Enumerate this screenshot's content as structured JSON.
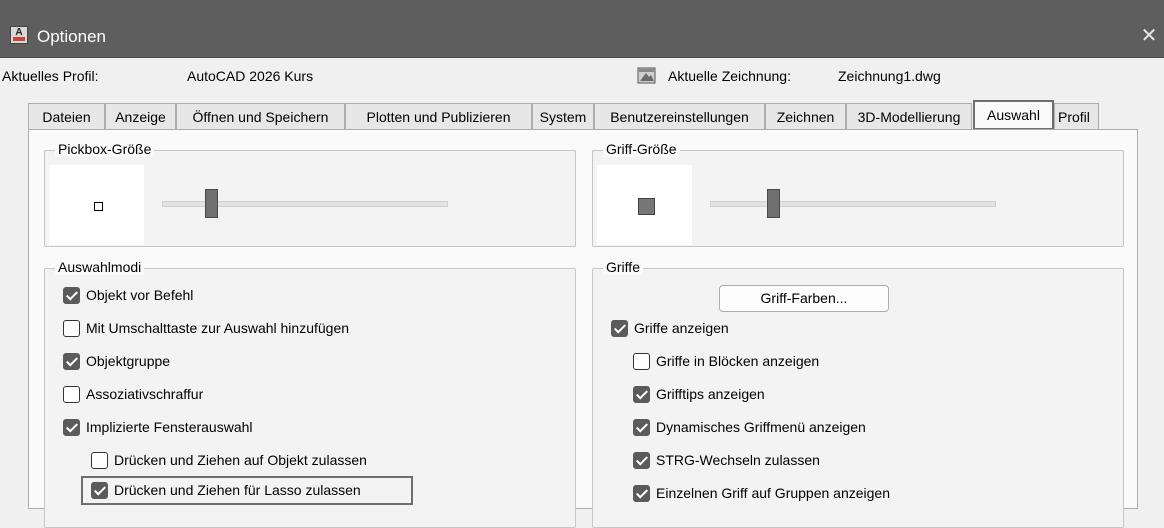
{
  "window": {
    "title": "Optionen",
    "app_icon_letter": "A"
  },
  "profile": {
    "label": "Aktuelles Profil:",
    "value": "AutoCAD 2026 Kurs",
    "drawing_label": "Aktuelle Zeichnung:",
    "drawing_value": "Zeichnung1.dwg"
  },
  "tabs": [
    {
      "label": "Dateien"
    },
    {
      "label": "Anzeige"
    },
    {
      "label": "Öffnen und Speichern"
    },
    {
      "label": "Plotten und Publizieren"
    },
    {
      "label": "System"
    },
    {
      "label": "Benutzereinstellungen"
    },
    {
      "label": "Zeichnen"
    },
    {
      "label": "3D-Modellierung"
    },
    {
      "label": "Auswahl",
      "active": true
    },
    {
      "label": "Profil"
    }
  ],
  "pickbox": {
    "title": "Pickbox-Größe",
    "slider_level": 0.15
  },
  "grip_size": {
    "title": "Griff-Größe",
    "slider_level": 0.2
  },
  "selection_modes": {
    "title": "Auswahlmodi",
    "items": [
      {
        "label": "Objekt vor Befehl",
        "checked": true
      },
      {
        "label": "Mit Umschalttaste zur Auswahl hinzufügen",
        "checked": false
      },
      {
        "label": "Objektgruppe",
        "checked": true
      },
      {
        "label": "Assoziativschraffur",
        "checked": false
      },
      {
        "label": "Implizierte Fensterauswahl",
        "checked": true
      },
      {
        "label": "Drücken und Ziehen auf Objekt zulassen",
        "checked": false
      },
      {
        "label": "Drücken und Ziehen für Lasso zulassen",
        "checked": true
      }
    ]
  },
  "grips": {
    "title": "Griffe",
    "colors_button": "Griff-Farben...",
    "items": [
      {
        "label": "Griffe anzeigen",
        "checked": true
      },
      {
        "label": "Griffe in Blöcken anzeigen",
        "checked": false
      },
      {
        "label": "Grifftips anzeigen",
        "checked": true
      },
      {
        "label": "Dynamisches Griffmenü anzeigen",
        "checked": true
      },
      {
        "label": "STRG-Wechseln zulassen",
        "checked": true
      },
      {
        "label": "Einzelnen Griff auf Gruppen anzeigen",
        "checked": true
      }
    ]
  },
  "colors": {
    "titlebar": "#5e5e5e",
    "checkbox_on": "#5b5b5b",
    "highlight_border": "#6e6e6e"
  }
}
